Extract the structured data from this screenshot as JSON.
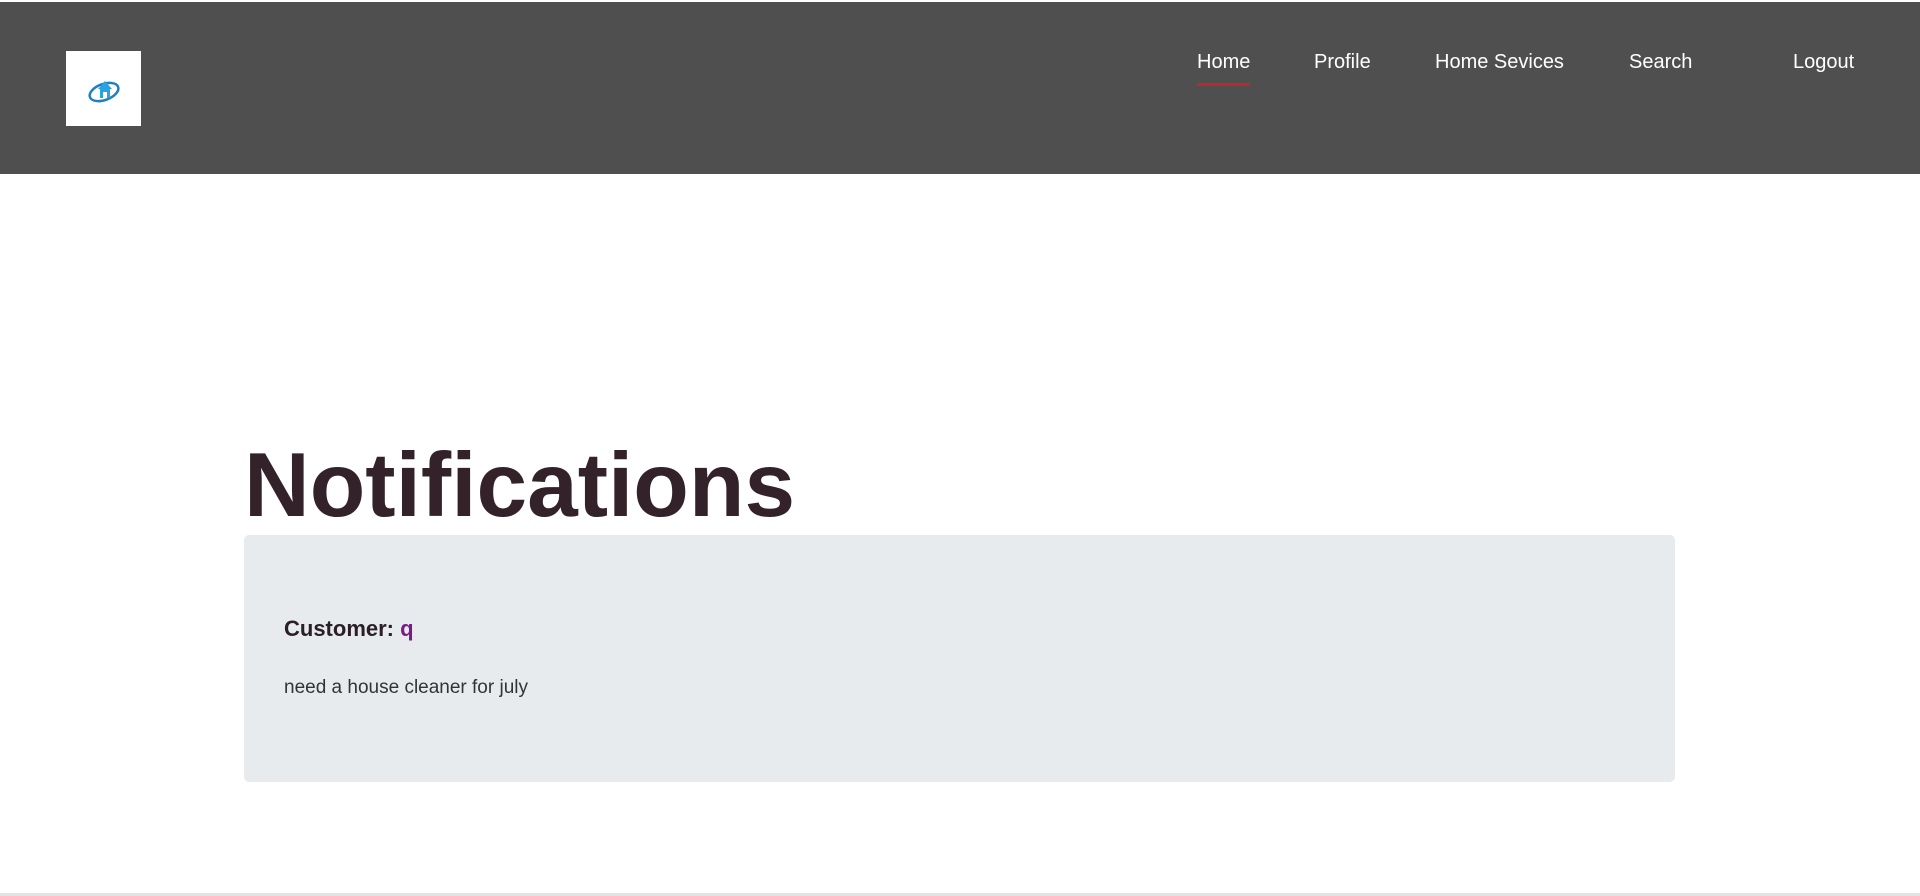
{
  "header": {
    "logo_icon": "home-services-logo-icon",
    "nav": {
      "home": "Home",
      "profile": "Profile",
      "home_services": "Home Sevices",
      "search": "Search",
      "logout": "Logout"
    },
    "active_item": "home"
  },
  "main": {
    "title": "Notifications",
    "notification": {
      "customer_label": "Customer: ",
      "customer_name": "q",
      "message": "need a house cleaner for july"
    }
  },
  "colors": {
    "header_bg": "#4f4f4f",
    "active_underline": "#c0272d",
    "card_bg": "#e8ebee",
    "customer_name": "#7a1a85",
    "title": "#33222a"
  }
}
